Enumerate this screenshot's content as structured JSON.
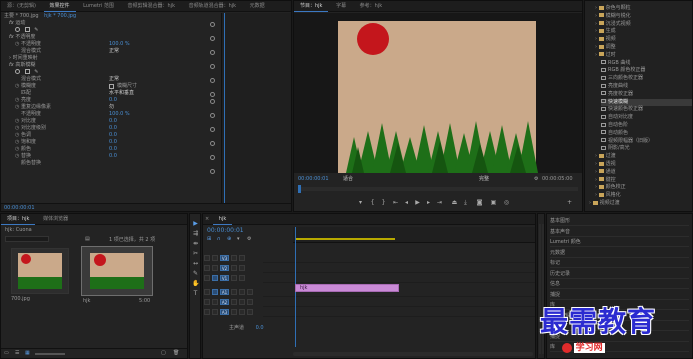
{
  "effect_controls": {
    "tabs": [
      "源：(无剪辑)",
      "效果控件",
      "Lumetri 范围",
      "音频剪辑混合器：hjk",
      "音频轨道混合器：hjk",
      "元数据"
    ],
    "active_tab": 1,
    "source_label": "主要 * 700.jpg",
    "clip_label": "hjk * 700.jpg",
    "sections": {
      "motion": "运动",
      "opacity_section": "不透明度",
      "time_remap": "时间重映射",
      "fx": "高斯模糊"
    },
    "opacity_props": [
      {
        "label": "不透明度",
        "value": "100.0 %"
      },
      {
        "label": "混合模式",
        "value": "正常"
      }
    ],
    "fx_props": [
      {
        "label": "模糊度",
        "value": "0.0"
      },
      {
        "label": "模糊尺寸",
        "value": "水平和垂直"
      },
      {
        "label": "重复边缘像素",
        "value": "勿"
      }
    ],
    "extra_props": [
      {
        "label": "不透明度",
        "value": "100.0 %"
      },
      {
        "label": "混合模式",
        "value": "正常"
      },
      {
        "label": "匹配",
        "value": "是"
      },
      {
        "label": "亮度",
        "value": "0.0"
      },
      {
        "label": "对比度",
        "value": "0.0"
      },
      {
        "label": "对比度级别",
        "value": "0.0"
      },
      {
        "label": "色调",
        "value": "0.0"
      },
      {
        "label": "饱和度",
        "value": "0.0"
      },
      {
        "label": "颜色",
        "value": "0.0"
      },
      {
        "label": "替换",
        "value": "0.0"
      }
    ],
    "footer_label": "颜色替换",
    "timecode": "00:00:00:01"
  },
  "program_monitor": {
    "tabs": [
      "节目：hjk",
      "字幕",
      "参考：hjk"
    ],
    "active_tab": 0,
    "timecode": "00:00:00:01",
    "fit": "适合",
    "quality": "完整",
    "end_time": "00:00:05:00",
    "colors": {
      "sky": "#caa98a",
      "sun": "#c4161c",
      "tree": "#1e6f18",
      "tree_dark": "#155510"
    }
  },
  "effects": {
    "items": [
      {
        "label": "杂色与颗粒",
        "kind": "folder",
        "indent": 1
      },
      {
        "label": "模糊与锐化",
        "kind": "folder",
        "indent": 1
      },
      {
        "label": "沉浸式视频",
        "kind": "folder",
        "indent": 1
      },
      {
        "label": "生成",
        "kind": "folder",
        "indent": 1
      },
      {
        "label": "视频",
        "kind": "folder",
        "indent": 1
      },
      {
        "label": "调整",
        "kind": "folder",
        "indent": 1
      },
      {
        "label": "过时",
        "kind": "folder",
        "indent": 1
      },
      {
        "label": "RGB 曲线",
        "kind": "fx",
        "indent": 2
      },
      {
        "label": "RGB 颜色校正器",
        "kind": "fx",
        "indent": 2
      },
      {
        "label": "三向颜色校正器",
        "kind": "fx",
        "indent": 2
      },
      {
        "label": "亮度曲线",
        "kind": "fx",
        "indent": 2
      },
      {
        "label": "亮度校正器",
        "kind": "fx",
        "indent": 2
      },
      {
        "label": "快速模糊",
        "kind": "fx",
        "indent": 2
      },
      {
        "label": "快速颜色校正器",
        "kind": "fx",
        "indent": 2
      },
      {
        "label": "自动对比度",
        "kind": "fx",
        "indent": 2
      },
      {
        "label": "自动色阶",
        "kind": "fx",
        "indent": 2
      },
      {
        "label": "自动颜色",
        "kind": "fx",
        "indent": 2
      },
      {
        "label": "视频限幅器（旧版）",
        "kind": "fx",
        "indent": 2
      },
      {
        "label": "阴影/高光",
        "kind": "fx",
        "indent": 2
      },
      {
        "label": "过渡",
        "kind": "folder",
        "indent": 1
      },
      {
        "label": "透视",
        "kind": "folder",
        "indent": 1
      },
      {
        "label": "通道",
        "kind": "folder",
        "indent": 1
      },
      {
        "label": "键控",
        "kind": "folder",
        "indent": 1
      },
      {
        "label": "颜色校正",
        "kind": "folder",
        "indent": 1
      },
      {
        "label": "风格化",
        "kind": "folder",
        "indent": 1
      },
      {
        "label": "视频过渡",
        "kind": "folder",
        "indent": 0
      }
    ],
    "selected_index": 12
  },
  "essential_panels": [
    "基本图形",
    "基本声音",
    "Lumetri 颜色",
    "元数据",
    "标记",
    "历史记录",
    "信息",
    "捕捉",
    "库",
    "音频剪辑",
    "效果",
    "捕捉",
    "库"
  ],
  "project": {
    "tabs": [
      "项目：hjk",
      "媒体浏览器"
    ],
    "active_tab": 0,
    "path": "hjk: Cuona",
    "count": "1 项已选择，共 2 项",
    "clips": [
      {
        "name": "700.jpg",
        "duration": ""
      },
      {
        "name": "hjk",
        "duration": "5:00"
      }
    ]
  },
  "timeline": {
    "tab": "hjk",
    "timecode": "00:00:00:01",
    "tracks": [
      {
        "name": "V3",
        "type": "video"
      },
      {
        "name": "V2",
        "type": "video"
      },
      {
        "name": "V1",
        "type": "video"
      },
      {
        "name": "A1",
        "type": "audio"
      },
      {
        "name": "A2",
        "type": "audio"
      },
      {
        "name": "A3",
        "type": "audio"
      }
    ],
    "master_label": "主声道",
    "master_value": "0.0",
    "clip": {
      "name": "hjk",
      "track": "V1"
    }
  },
  "watermark": {
    "text": "最需教育",
    "url_text": "学习网"
  }
}
